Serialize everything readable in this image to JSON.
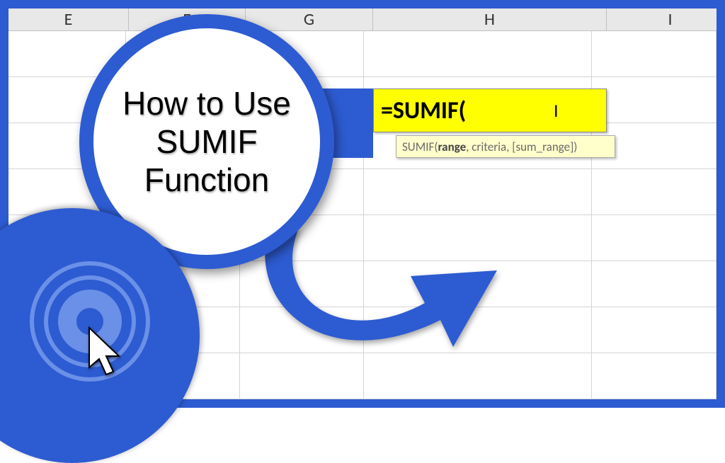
{
  "columns": {
    "E": "E",
    "F": "F",
    "G": "G",
    "H": "H",
    "I": "I"
  },
  "formula_cell": {
    "text": "=SUMIF("
  },
  "tooltip": {
    "fn": "SUMIF(",
    "arg_bold": "range",
    "args_rest": ", criteria, [sum_range])"
  },
  "badge": {
    "line1": "How to Use",
    "line2": "SUMIF",
    "line3": "Function"
  },
  "colors": {
    "accent": "#2d5bd1",
    "highlight": "#ffff00",
    "tooltip_bg": "#ffffcc"
  }
}
